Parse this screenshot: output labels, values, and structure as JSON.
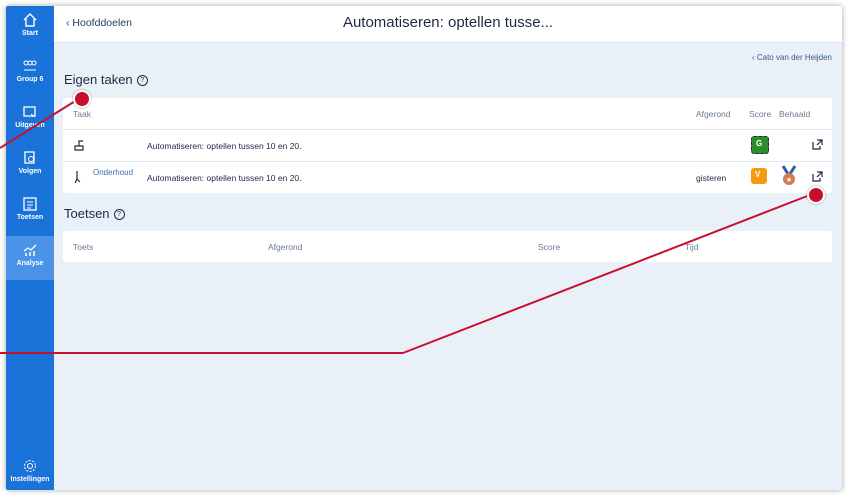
{
  "sidebar": {
    "items": [
      {
        "label": "Start",
        "icon": "home-icon"
      },
      {
        "label": "Group 6",
        "icon": "group-icon"
      },
      {
        "label": "Uitgeven",
        "icon": "assign-icon"
      },
      {
        "label": "Volgen",
        "icon": "follow-icon"
      },
      {
        "label": "Toetsen",
        "icon": "test-icon"
      },
      {
        "label": "Analyse",
        "icon": "analysis-icon"
      }
    ],
    "settings_label": "Instellingen",
    "settings_icon": "gear-icon"
  },
  "header": {
    "back_label": "Hoofddoelen",
    "title": "Automatiseren: optellen tusse..."
  },
  "student_link": "Cato van der Heijden",
  "tasks": {
    "title": "Eigen taken",
    "columns": {
      "task": "Taak",
      "done": "Afgerond",
      "score": "Score",
      "achieved": "Behaald"
    },
    "rows": [
      {
        "tag": "",
        "name": "Automatiseren: optellen tussen 10 en 20.",
        "done": "",
        "score_badge": "G",
        "score_color": "#2e8b2e"
      },
      {
        "tag": "Onderhoud",
        "name": "Automatiseren: optellen tussen 10 en 20.",
        "done": "gisteren",
        "score_badge": "V",
        "score_color": "#f59a10"
      }
    ]
  },
  "tests": {
    "title": "Toetsen",
    "columns": {
      "test": "Toets",
      "done": "Afgerond",
      "score": "Score",
      "time": "Tijd"
    }
  },
  "colors": {
    "sidebar": "#1a73d9",
    "annotation": "#c8102e"
  }
}
